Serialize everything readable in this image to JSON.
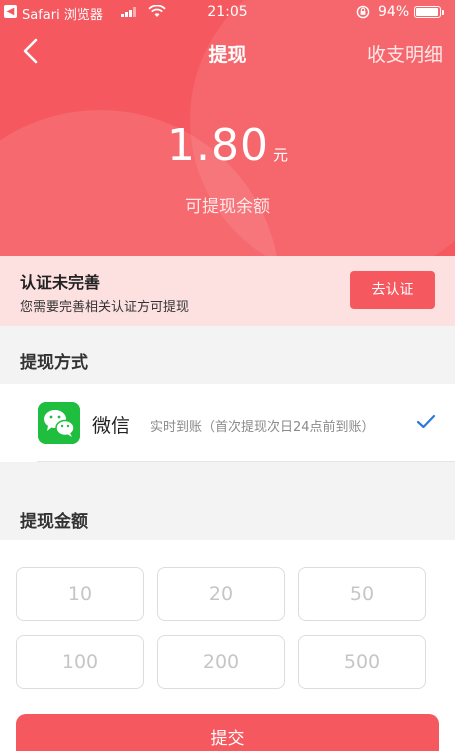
{
  "status_bar": {
    "app_name": "Safari 浏览器",
    "time": "21:05",
    "battery_percent": "94%",
    "battery_level": 0.94
  },
  "nav": {
    "title": "提现",
    "right_link": "收支明细"
  },
  "balance": {
    "amount": "1.80",
    "unit": "元",
    "label": "可提现余额"
  },
  "verification": {
    "title": "认证未完善",
    "description": "您需要完善相关认证方可提现",
    "button_label": "去认证"
  },
  "withdraw_method": {
    "section_title": "提现方式",
    "method_name": "微信",
    "method_desc": "实时到账（首次提现次日24点前到账）",
    "selected": true
  },
  "withdraw_amount": {
    "section_title": "提现金额",
    "options": [
      "10",
      "20",
      "50",
      "100",
      "200",
      "500"
    ]
  },
  "submit_label": "提交",
  "colors": {
    "accent": "#f5585e",
    "notice_bg": "#fde0e0",
    "wechat_green": "#1fbe3e",
    "check_blue": "#2b7bd6"
  }
}
